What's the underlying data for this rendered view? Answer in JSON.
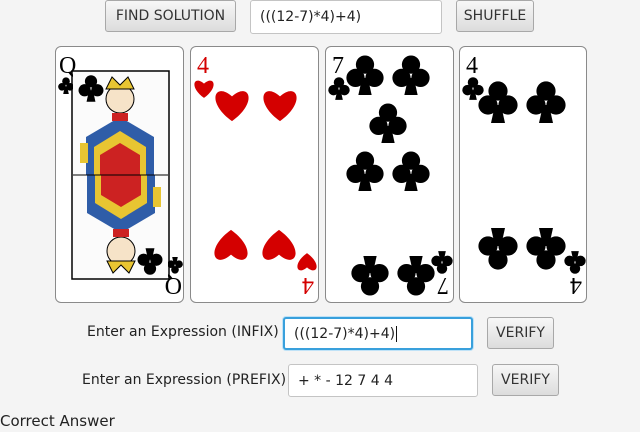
{
  "toolbar": {
    "find_label": "FIND SOLUTION",
    "solution_value": "(((12-7)*4)+4)",
    "shuffle_label": "SHUFFLE"
  },
  "cards": [
    {
      "rank": "Q",
      "suit": "clubs",
      "color": "#000000"
    },
    {
      "rank": "4",
      "suit": "hearts",
      "color": "#d40000"
    },
    {
      "rank": "7",
      "suit": "clubs",
      "color": "#000000"
    },
    {
      "rank": "4",
      "suit": "clubs",
      "color": "#000000"
    }
  ],
  "infix": {
    "label": "Enter an Expression (INFIX)",
    "value": "(((12-7)*4)+4)",
    "verify_label": "VERIFY"
  },
  "prefix": {
    "label": "Enter an Expression (PREFIX)",
    "value": "+ * - 12 7 4 4",
    "verify_label": "VERIFY"
  },
  "status": {
    "message": "Correct Answer"
  },
  "colors": {
    "focus": "#39a0dc",
    "red_suit": "#d40000"
  }
}
